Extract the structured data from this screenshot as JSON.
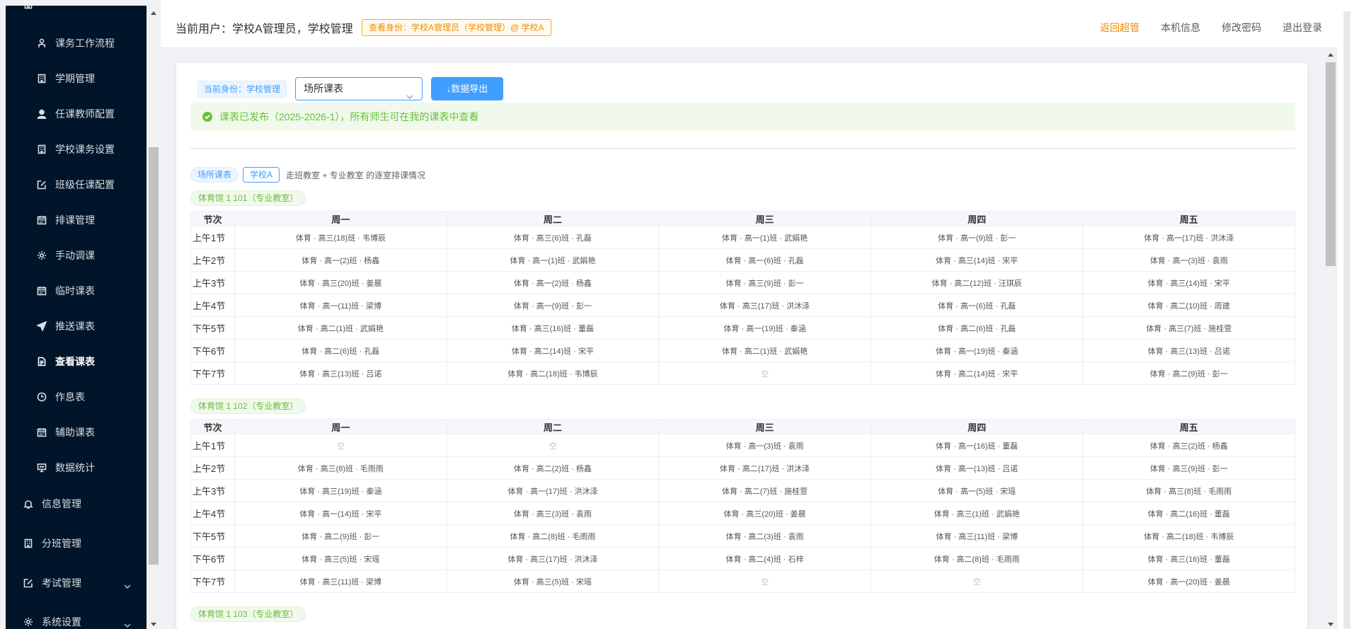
{
  "sidebar": {
    "items": [
      {
        "label": "课务工作流程",
        "icon": "workflow-icon",
        "name": "sidebar-item-workflow"
      },
      {
        "label": "学期管理",
        "icon": "building-icon",
        "name": "sidebar-item-semester"
      },
      {
        "label": "任课教师配置",
        "icon": "user-icon",
        "name": "sidebar-item-teacher-config"
      },
      {
        "label": "学校课务设置",
        "icon": "building-icon",
        "name": "sidebar-item-school-course"
      },
      {
        "label": "班级任课配置",
        "icon": "edit-icon",
        "name": "sidebar-item-class-config"
      },
      {
        "label": "排课管理",
        "icon": "calendar-icon",
        "name": "sidebar-item-scheduling"
      },
      {
        "label": "手动调课",
        "icon": "gear-icon",
        "name": "sidebar-item-manual-adjust"
      },
      {
        "label": "临时课表",
        "icon": "calendar-icon",
        "name": "sidebar-item-temp-timetable"
      },
      {
        "label": "推送课表",
        "icon": "send-icon",
        "name": "sidebar-item-push"
      },
      {
        "label": "查看课表",
        "icon": "document-icon",
        "name": "sidebar-item-view",
        "active": true
      },
      {
        "label": "作息表",
        "icon": "clock-icon",
        "name": "sidebar-item-schedule"
      },
      {
        "label": "辅助课表",
        "icon": "calendar-icon",
        "name": "sidebar-item-assist"
      },
      {
        "label": "数据统计",
        "icon": "monitor-icon",
        "name": "sidebar-item-stats"
      }
    ],
    "top_items": [
      {
        "label": "信息管理",
        "icon": "bell-icon",
        "name": "sidebar-item-info"
      },
      {
        "label": "分班管理",
        "icon": "building-icon",
        "name": "sidebar-item-class-split"
      },
      {
        "label": "考试管理",
        "icon": "edit-icon",
        "name": "sidebar-item-exam",
        "chevron": true
      },
      {
        "label": "系统设置",
        "icon": "gear-icon",
        "name": "sidebar-item-system",
        "chevron": true
      }
    ]
  },
  "header": {
    "current_user": "当前用户：学校A管理员，学校管理",
    "identity_badge": "查看身份：学校A管理员（学校管理）@ 学校A",
    "links": [
      "返回超管",
      "本机信息",
      "修改密码",
      "退出登录"
    ]
  },
  "toolbar": {
    "identity_tag": "当前身份：学校管理",
    "select_value": "场所课表",
    "export_button": "数据导出"
  },
  "alert": {
    "text": "课表已发布（2025-2026-1），所有师生可在我的课表中查看"
  },
  "filter": {
    "tag1": "场所课表",
    "tag2": "学校A",
    "description": "走班教室 + 专业教室 的逐室排课情况"
  },
  "colors": {
    "sidebar_bg": "#001529",
    "primary": "#409eff",
    "success": "#67c23a",
    "warning": "#f08c00"
  },
  "timetables": [
    {
      "venue": "体育馆 1 101（专业教室）",
      "headers": [
        "节次",
        "周一",
        "周二",
        "周三",
        "周四",
        "周五"
      ],
      "rows": [
        [
          "上午1节",
          "体育 · 高三(18)班 · 韦博辰",
          "体育 · 高三(6)班 · 孔磊",
          "体育 · 高一(1)班 · 武娟艳",
          "体育 · 高一(9)班 · 彭一",
          "体育 · 高一(17)班 · 洪沐泽"
        ],
        [
          "上午2节",
          "体育 · 高一(2)班 · 杨鑫",
          "体育 · 高一(1)班 · 武娟艳",
          "体育 · 高一(6)班 · 孔磊",
          "体育 · 高三(14)班 · 宋平",
          "体育 · 高一(3)班 · 袁雨"
        ],
        [
          "上午3节",
          "体育 · 高三(20)班 · 姜晨",
          "体育 · 高一(2)班 · 杨鑫",
          "体育 · 高三(9)班 · 彭一",
          "体育 · 高二(12)班 · 汪琪辰",
          "体育 · 高三(14)班 · 宋平"
        ],
        [
          "上午4节",
          "体育 · 高一(11)班 · 梁博",
          "体育 · 高一(9)班 · 彭一",
          "体育 · 高三(17)班 · 洪沐泽",
          "体育 · 高一(6)班 · 孔磊",
          "体育 · 高二(10)班 · 周建"
        ],
        [
          "下午5节",
          "体育 · 高二(1)班 · 武娟艳",
          "体育 · 高三(16)班 · 董磊",
          "体育 · 高一(19)班 · 秦涵",
          "体育 · 高二(6)班 · 孔磊",
          "体育 · 高三(7)班 · 施桂萱"
        ],
        [
          "下午6节",
          "体育 · 高二(6)班 · 孔磊",
          "体育 · 高二(14)班 · 宋平",
          "体育 · 高二(1)班 · 武娟艳",
          "体育 · 高一(19)班 · 秦涵",
          "体育 · 高三(13)班 · 吕诺"
        ],
        [
          "下午7节",
          "体育 · 高三(13)班 · 吕诺",
          "体育 · 高二(18)班 · 韦博辰",
          "空",
          "体育 · 高二(14)班 · 宋平",
          "体育 · 高二(9)班 · 彭一"
        ]
      ]
    },
    {
      "venue": "体育馆 1 102（专业教室）",
      "headers": [
        "节次",
        "周一",
        "周二",
        "周三",
        "周四",
        "周五"
      ],
      "rows": [
        [
          "上午1节",
          "空",
          "空",
          "体育 · 高一(3)班 · 袁雨",
          "体育 · 高一(16)班 · 董磊",
          "体育 · 高三(2)班 · 杨鑫"
        ],
        [
          "上午2节",
          "体育 · 高三(8)班 · 毛雨雨",
          "体育 · 高二(2)班 · 杨鑫",
          "体育 · 高二(17)班 · 洪沐泽",
          "体育 · 高一(13)班 · 吕诺",
          "体育 · 高三(9)班 · 彭一"
        ],
        [
          "上午3节",
          "体育 · 高三(19)班 · 秦涵",
          "体育 · 高一(17)班 · 洪沐泽",
          "体育 · 高二(7)班 · 施桂萱",
          "体育 · 高一(5)班 · 宋瑶",
          "体育 · 高三(8)班 · 毛雨雨"
        ],
        [
          "上午4节",
          "体育 · 高一(14)班 · 宋平",
          "体育 · 高三(3)班 · 袁雨",
          "体育 · 高三(20)班 · 姜晨",
          "体育 · 高三(1)班 · 武娟艳",
          "体育 · 高二(16)班 · 董磊"
        ],
        [
          "下午5节",
          "体育 · 高二(9)班 · 彭一",
          "体育 · 高二(8)班 · 毛雨雨",
          "体育 · 高二(3)班 · 袁雨",
          "体育 · 高三(11)班 · 梁博",
          "体育 · 高二(18)班 · 韦博辰"
        ],
        [
          "下午6节",
          "体育 · 高三(5)班 · 宋瑶",
          "体育 · 高三(17)班 · 洪沐泽",
          "体育 · 高二(4)班 · 石梓",
          "体育 · 高二(8)班 · 毛雨雨",
          "体育 · 高三(16)班 · 董磊"
        ],
        [
          "下午7节",
          "体育 · 高三(11)班 · 梁博",
          "体育 · 高三(5)班 · 宋瑶",
          "空",
          "空",
          "体育 · 高一(20)班 · 姜晨"
        ]
      ]
    },
    {
      "venue": "体育馆 1 103（专业教室）"
    }
  ]
}
